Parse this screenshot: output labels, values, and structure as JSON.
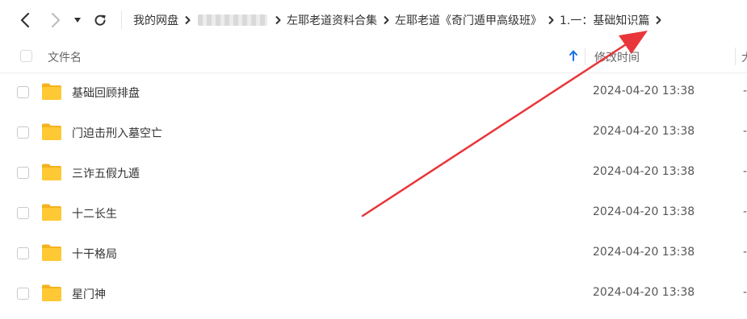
{
  "nav": {
    "back_icon": "chevron-left-icon",
    "forward_icon": "chevron-right-icon",
    "history_icon": "caret-down-icon",
    "refresh_icon": "refresh-icon"
  },
  "breadcrumb": {
    "items": [
      "我的网盘",
      "",
      "左耶老道资料合集",
      "左耶老道《奇门遁甲高级班》",
      "1.一：基础知识篇"
    ]
  },
  "columns": {
    "name": "文件名",
    "mtime": "修改时间",
    "size": "大"
  },
  "files": [
    {
      "name": "基础回顾排盘",
      "time": "2024-04-20 13:38",
      "size": "-"
    },
    {
      "name": "门迫击刑入墓空亡",
      "time": "2024-04-20 13:38",
      "size": "-"
    },
    {
      "name": "三诈五假九遁",
      "time": "2024-04-20 13:38",
      "size": "-"
    },
    {
      "name": "十二长生",
      "time": "2024-04-20 13:38",
      "size": "-"
    },
    {
      "name": "十干格局",
      "time": "2024-04-20 13:38",
      "size": "-"
    },
    {
      "name": "星门神",
      "time": "2024-04-20 13:38",
      "size": "-"
    }
  ],
  "colors": {
    "folder": "#FFC935",
    "folder_back": "#F5B21F",
    "accent": "#1A73E8",
    "annotation": "#E8363A"
  }
}
